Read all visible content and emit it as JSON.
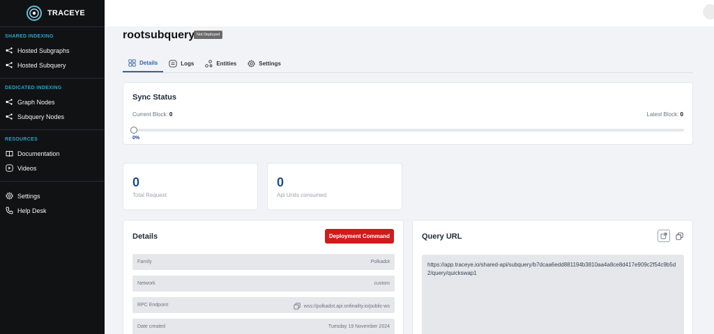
{
  "app": {
    "brand": "TRACEYE"
  },
  "sidebar": {
    "sections": [
      {
        "heading": "SHARED INDEXING",
        "items": [
          {
            "label": "Hosted Subgraphs",
            "icon": "nodes-icon"
          },
          {
            "label": "Hosted Subquery",
            "icon": "nodes-icon"
          }
        ]
      },
      {
        "heading": "DEDICATED INDEXING",
        "items": [
          {
            "label": "Graph Nodes",
            "icon": "nodes-icon"
          },
          {
            "label": "Subquery Nodes",
            "icon": "nodes-icon"
          }
        ]
      },
      {
        "heading": "RESOURCES",
        "items": [
          {
            "label": "Documentation",
            "icon": "book-icon"
          },
          {
            "label": "Videos",
            "icon": "play-icon"
          }
        ]
      },
      {
        "heading": "",
        "items": [
          {
            "label": "Settings",
            "icon": "gear-icon"
          },
          {
            "label": "Help Desk",
            "icon": "phone-icon"
          }
        ]
      }
    ]
  },
  "page": {
    "title": "rootsubquery",
    "status_badge": "Not Deployed"
  },
  "tabs": [
    {
      "label": "Details",
      "icon": "grid-icon",
      "active": true
    },
    {
      "label": "Logs",
      "icon": "logs-icon",
      "active": false
    },
    {
      "label": "Entities",
      "icon": "entities-icon",
      "active": false
    },
    {
      "label": "Settings",
      "icon": "gear-icon",
      "active": false
    }
  ],
  "sync": {
    "title": "Sync Status",
    "current_label": "Current Block:",
    "current_value": "0",
    "latest_label": "Latest Block:",
    "latest_value": "0",
    "progress_text": "0%",
    "progress": 0
  },
  "stats": [
    {
      "value": "0",
      "label": "Total Request"
    },
    {
      "value": "0",
      "label": "Api Units consumed"
    }
  ],
  "details": {
    "title": "Details",
    "deploy_button": "Deployment Command",
    "rows": [
      {
        "key": "Family",
        "value": "Polkadot"
      },
      {
        "key": "Network",
        "value": "custom"
      },
      {
        "key": "RPC Endpoint",
        "value": "wss://polkadot.api.onfinality.io/public-ws"
      },
      {
        "key": "Date created",
        "value": "Tuesday 19 November 2024"
      }
    ]
  },
  "query": {
    "title": "Query URL",
    "url": "https://app.traceye.io/shared-api/subquery/b7dcaa6edd881194b3810aa4a8ce8d417e909c2f54c9b5d2/query/quickswap1"
  },
  "colors": {
    "sidebar_bg": "#111214",
    "accent": "#3563a8",
    "section_heading": "#29a3c9",
    "deploy_button": "#d11a1a",
    "stat_value": "#1e4b8f"
  }
}
